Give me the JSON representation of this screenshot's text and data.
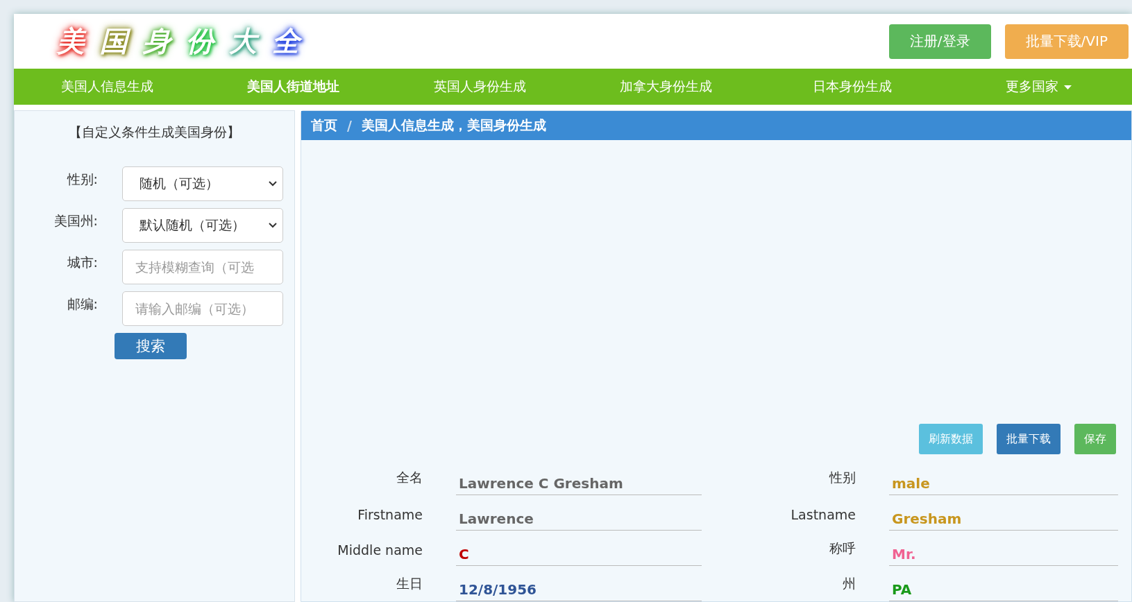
{
  "header": {
    "logo": "美国身份大全",
    "buttons": [
      {
        "label": "注册/登录",
        "kind": "success"
      },
      {
        "label": "批量下载/VIP",
        "kind": "warning"
      }
    ]
  },
  "nav": [
    {
      "label": "美国人信息生成",
      "selected": false
    },
    {
      "label": "美国人街道地址",
      "selected": true
    },
    {
      "label": "英国人身份生成",
      "selected": false
    },
    {
      "label": "加拿大身份生成",
      "selected": false
    },
    {
      "label": "日本身份生成",
      "selected": false
    },
    {
      "label": "更多国家",
      "selected": false,
      "kind": "dropdown"
    }
  ],
  "sidebar": {
    "title": "【自定义条件生成美国身份】",
    "fields": [
      {
        "label": "性别:",
        "kind": "select",
        "value": "随机（可选）"
      },
      {
        "label": "美国州:",
        "kind": "select",
        "value": "默认随机（可选）"
      },
      {
        "label": "城市:",
        "kind": "input",
        "placeholder": "支持模糊查询（可选"
      },
      {
        "label": "邮编:",
        "kind": "input",
        "placeholder": "请输入邮编（可选）"
      }
    ],
    "search_button": "搜索"
  },
  "breadcrumb": {
    "items": [
      "首页",
      "美国人信息生成，美国身份生成"
    ],
    "separator": "/"
  },
  "actions": [
    {
      "label": "刷新数据",
      "kind": "info"
    },
    {
      "label": "批量下载",
      "kind": "primary"
    },
    {
      "label": "保存",
      "kind": "success"
    }
  ],
  "details": [
    {
      "label": "全名",
      "value": "Lawrence C Gresham",
      "color": "#666666"
    },
    {
      "label": "性别",
      "value": "male",
      "color": "#c8961e"
    },
    {
      "label": "Firstname",
      "value": "Lawrence",
      "color": "#666666"
    },
    {
      "label": "Lastname",
      "value": "Gresham",
      "color": "#c8961e"
    },
    {
      "label": "Middle name",
      "value": "C",
      "color": "#c00000"
    },
    {
      "label": "称呼",
      "value": "Mr.",
      "color": "#f06292"
    },
    {
      "label": "生日",
      "value": "12/8/1956",
      "color": "#2f5496"
    },
    {
      "label": "州",
      "value": "PA",
      "color": "#1a9a1a"
    }
  ]
}
